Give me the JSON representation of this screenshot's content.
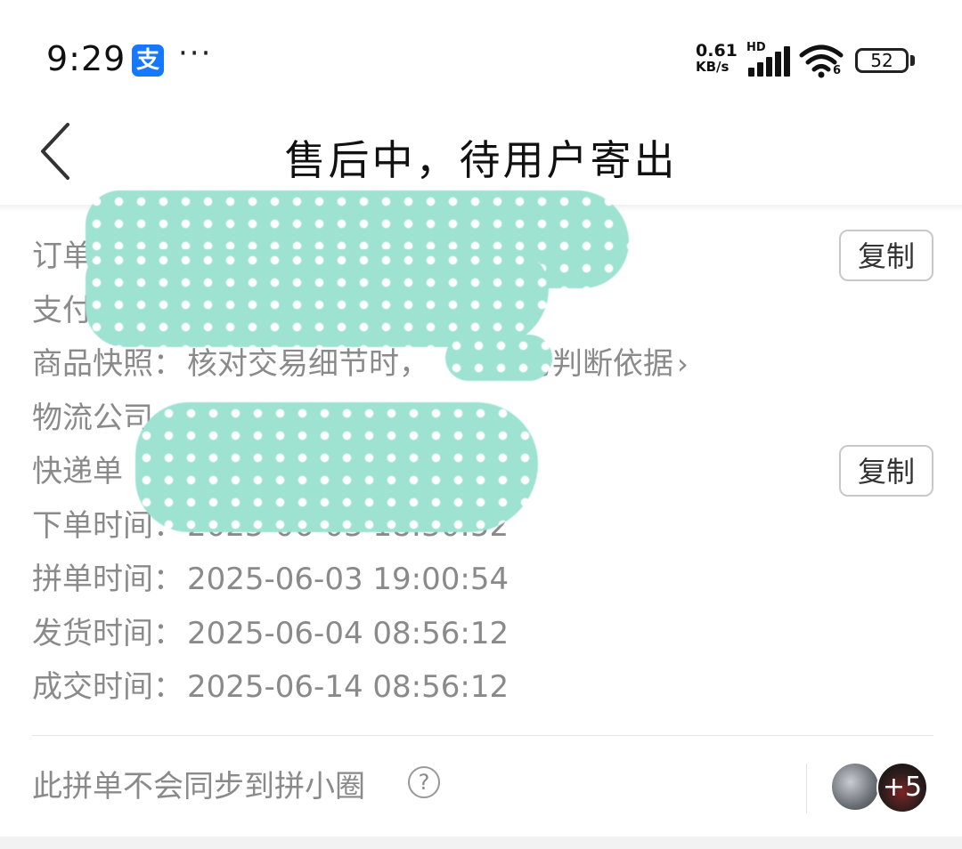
{
  "status_bar": {
    "time": "9:29",
    "app_badge": "支",
    "more": "···",
    "net_speed_value": "0.61",
    "net_speed_unit": "KB/s",
    "signal_label": "HD",
    "wifi_label": "6",
    "battery": "52",
    "icons": [
      "alipay-icon",
      "signal-icon",
      "wifi-icon",
      "battery-icon"
    ]
  },
  "header": {
    "title": "售后中，待用户寄出",
    "back_icon": "chevron-left-icon"
  },
  "info": {
    "order_label": "订单",
    "pay_label": "支付",
    "snapshot_label": "商品快照：",
    "snapshot_value": "核对交易细节时，",
    "snapshot_tail": "作为判断依据",
    "logistics_label": "物流公司",
    "tracking_label": "快递单",
    "copy_label": "复制",
    "order_time_label": "下单时间：",
    "order_time_value": "2025-06-03 18:30:52",
    "group_time_label": "拼单时间：",
    "group_time_value": "2025-06-03 19:00:54",
    "ship_time_label": "发货时间：",
    "ship_time_value": "2025-06-04 08:56:12",
    "deal_time_label": "成交时间：",
    "deal_time_value": "2025-06-14 08:56:12"
  },
  "footer": {
    "sync_text": "此拼单不会同步到拼小圈",
    "help": "?",
    "more_count": "+5"
  }
}
